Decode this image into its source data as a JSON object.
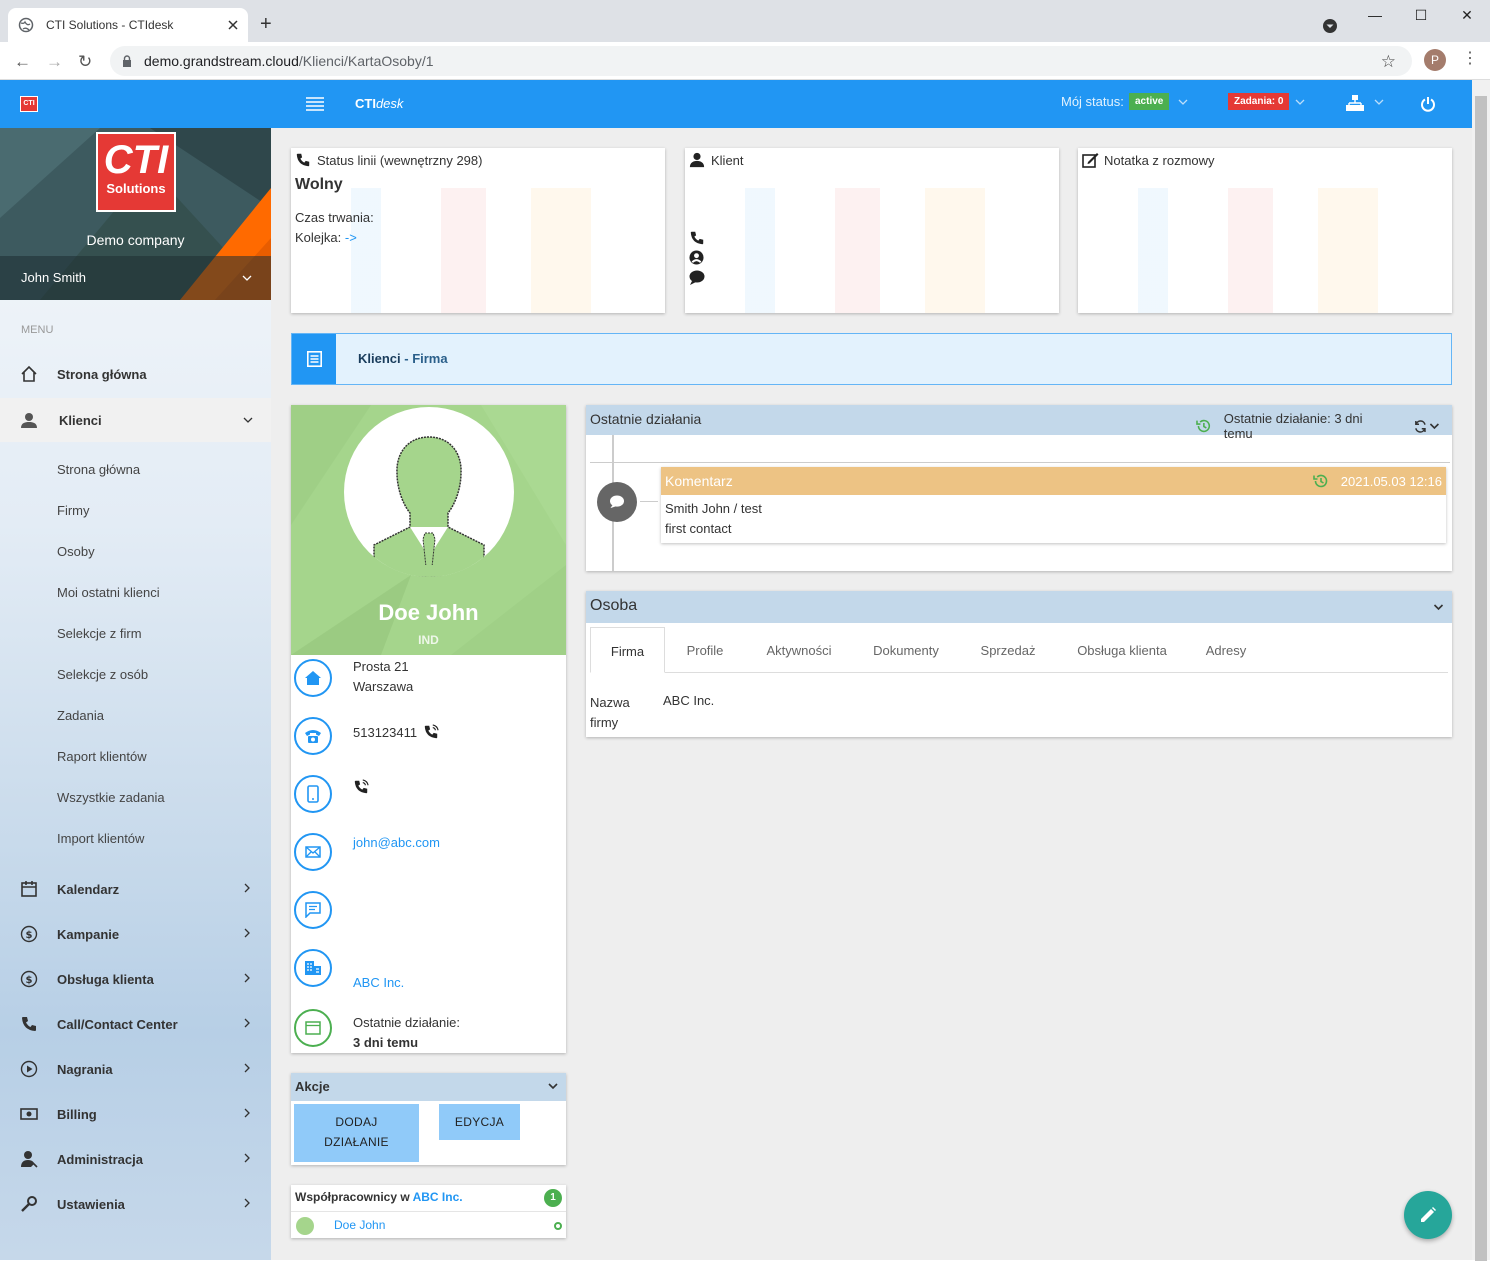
{
  "browser": {
    "tab_title": "CTI Solutions - CTIdesk",
    "url_host": "demo.grandstream.cloud",
    "url_path": "/Klienci/KartaOsoby/1",
    "profile_initial": "P"
  },
  "header": {
    "brand_bold": "CTI",
    "brand_italic": "desk",
    "logo_text": "CTI",
    "status_label": "Mój status:",
    "status_value": "active",
    "tasks_label": "Zadania: 0"
  },
  "sidebar": {
    "logo_big": "CTI",
    "logo_small": "Solutions",
    "company": "Demo company",
    "user": "John Smith",
    "menu_label": "MENU",
    "items": [
      {
        "label": "Strona główna",
        "icon": "home-icon"
      },
      {
        "label": "Klienci",
        "icon": "user-icon"
      },
      {
        "label": "Kalendarz",
        "icon": "calendar-icon"
      },
      {
        "label": "Kampanie",
        "icon": "dollar-icon"
      },
      {
        "label": "Obsługa klienta",
        "icon": "dollar-icon"
      },
      {
        "label": "Call/Contact Center",
        "icon": "phone-icon"
      },
      {
        "label": "Nagrania",
        "icon": "play-icon"
      },
      {
        "label": "Billing",
        "icon": "money-icon"
      },
      {
        "label": "Administracja",
        "icon": "admin-icon"
      },
      {
        "label": "Ustawienia",
        "icon": "wrench-icon"
      }
    ],
    "subitems": [
      "Strona główna",
      "Firmy",
      "Osoby",
      "Moi ostatni klienci",
      "Selekcje z firm",
      "Selekcje z osób",
      "Zadania",
      "Raport klientów",
      "Wszystkie zadania",
      "Import klientów"
    ]
  },
  "cards": {
    "line_status_title": "Status linii (wewnętrzny 298)",
    "line_status_value": "Wolny",
    "duration_label": "Czas trwania:",
    "queue_label": "Kolejka:",
    "queue_link": "->",
    "client_title": "Klient",
    "note_title": "Notatka z rozmowy"
  },
  "breadcrumb": {
    "root": "Klienci",
    "sep": " - ",
    "current": "Firma"
  },
  "profile": {
    "name": "Doe John",
    "type": "IND",
    "street": "Prosta 21",
    "city": "Warszawa",
    "phone": "513123411",
    "email": "john@abc.com",
    "company": "ABC Inc.",
    "last_action_label": "Ostatnie działanie:",
    "last_action_value": "3 dni temu"
  },
  "actions": {
    "title": "Akcje",
    "add_line1": "DODAJ",
    "add_line2": "DZIAŁANIE",
    "edit": "EDYCJA"
  },
  "coworkers": {
    "title": "Współpracownicy w",
    "company": "ABC Inc.",
    "count": "1",
    "member": "Doe John"
  },
  "recent": {
    "title": "Ostatnie działania",
    "summary": "Ostatnie działanie: 3 dni temu",
    "entry_type": "Komentarz",
    "entry_date": "2021.05.03 12:16",
    "entry_author": "Smith John / test",
    "entry_text": "first contact"
  },
  "person": {
    "title": "Osoba",
    "tabs": [
      "Firma",
      "Profile",
      "Aktywności",
      "Dokumenty",
      "Sprzedaż",
      "Obsługa klienta",
      "Adresy"
    ],
    "field_label_1": "Nazwa",
    "field_label_2": "firmy",
    "field_value": "ABC Inc."
  },
  "colors": {
    "primary": "#2196f3",
    "accent_red": "#e53935",
    "success": "#4caf50",
    "comment_header": "#edc384",
    "profile_bg": "#a5d58c",
    "fab": "#26a69a"
  }
}
